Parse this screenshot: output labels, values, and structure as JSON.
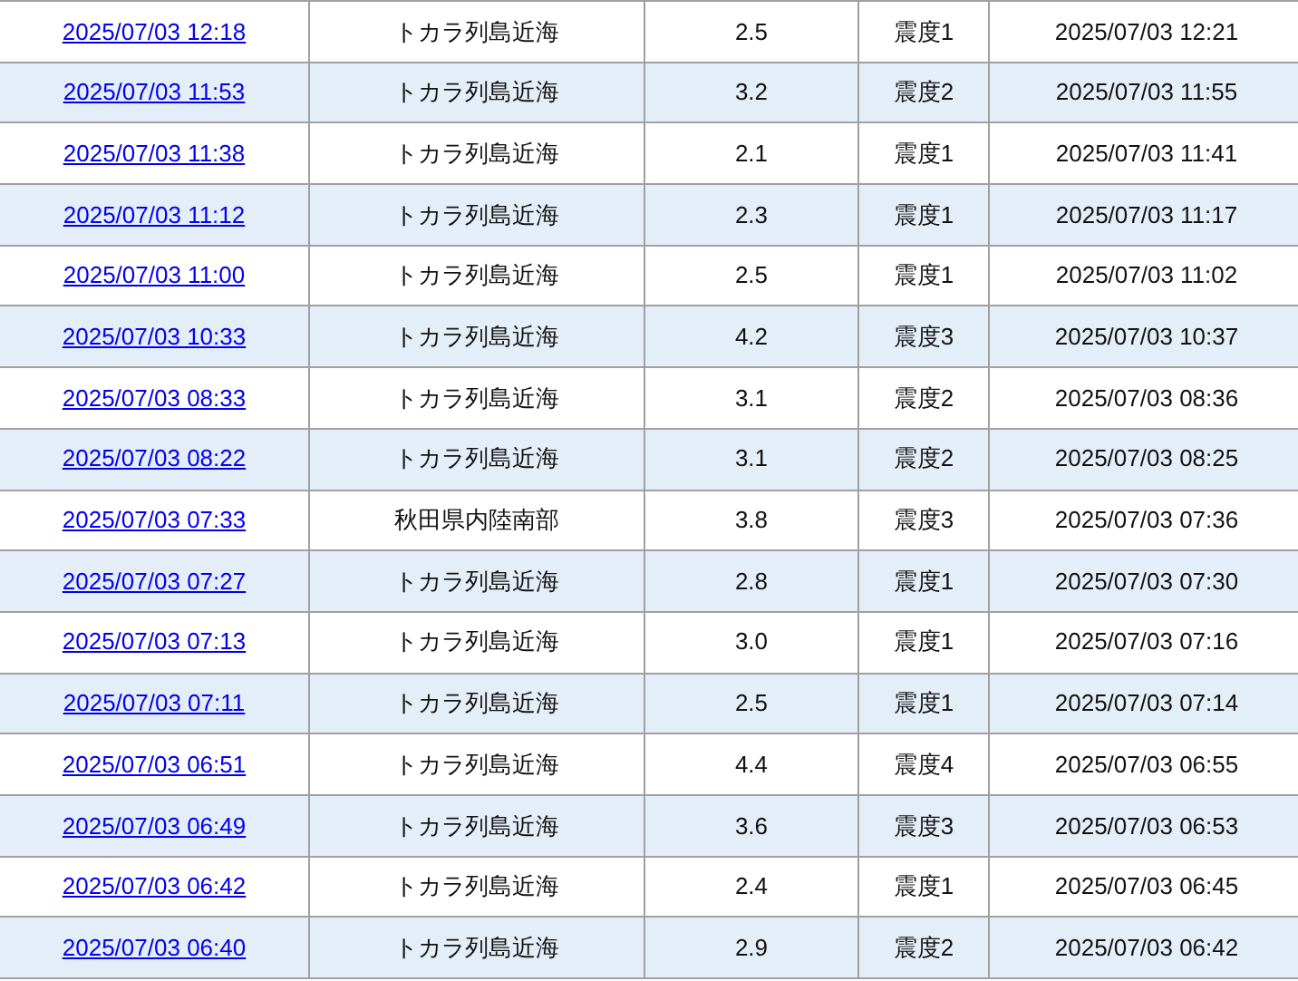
{
  "table": {
    "rows": [
      {
        "cells": [
          "2025/07/03 12:18",
          "トカラ列島近海",
          "2.5",
          "震度1",
          "2025/07/03 12:21"
        ]
      },
      {
        "cells": [
          "2025/07/03 11:53",
          "トカラ列島近海",
          "3.2",
          "震度2",
          "2025/07/03 11:55"
        ]
      },
      {
        "cells": [
          "2025/07/03 11:38",
          "トカラ列島近海",
          "2.1",
          "震度1",
          "2025/07/03 11:41"
        ]
      },
      {
        "cells": [
          "2025/07/03 11:12",
          "トカラ列島近海",
          "2.3",
          "震度1",
          "2025/07/03 11:17"
        ]
      },
      {
        "cells": [
          "2025/07/03 11:00",
          "トカラ列島近海",
          "2.5",
          "震度1",
          "2025/07/03 11:02"
        ]
      },
      {
        "cells": [
          "2025/07/03 10:33",
          "トカラ列島近海",
          "4.2",
          "震度3",
          "2025/07/03 10:37"
        ]
      },
      {
        "cells": [
          "2025/07/03 08:33",
          "トカラ列島近海",
          "3.1",
          "震度2",
          "2025/07/03 08:36"
        ]
      },
      {
        "cells": [
          "2025/07/03 08:22",
          "トカラ列島近海",
          "3.1",
          "震度2",
          "2025/07/03 08:25"
        ]
      },
      {
        "cells": [
          "2025/07/03 07:33",
          "秋田県内陸南部",
          "3.8",
          "震度3",
          "2025/07/03 07:36"
        ]
      },
      {
        "cells": [
          "2025/07/03 07:27",
          "トカラ列島近海",
          "2.8",
          "震度1",
          "2025/07/03 07:30"
        ]
      },
      {
        "cells": [
          "2025/07/03 07:13",
          "トカラ列島近海",
          "3.0",
          "震度1",
          "2025/07/03 07:16"
        ]
      },
      {
        "cells": [
          "2025/07/03 07:11",
          "トカラ列島近海",
          "2.5",
          "震度1",
          "2025/07/03 07:14"
        ]
      },
      {
        "cells": [
          "2025/07/03 06:51",
          "トカラ列島近海",
          "4.4",
          "震度4",
          "2025/07/03 06:55"
        ]
      },
      {
        "cells": [
          "2025/07/03 06:49",
          "トカラ列島近海",
          "3.6",
          "震度3",
          "2025/07/03 06:53"
        ]
      },
      {
        "cells": [
          "2025/07/03 06:42",
          "トカラ列島近海",
          "2.4",
          "震度1",
          "2025/07/03 06:45"
        ]
      },
      {
        "cells": [
          "2025/07/03 06:40",
          "トカラ列島近海",
          "2.9",
          "震度2",
          "2025/07/03 06:42"
        ]
      }
    ]
  }
}
